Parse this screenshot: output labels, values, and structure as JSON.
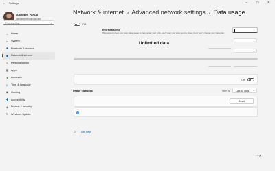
{
  "window": {
    "title": "Settings",
    "back_glyph": "←",
    "minimize_glyph": "–",
    "maximize_glyph": "□",
    "close_glyph": "✕"
  },
  "profile": {
    "name": "ABHIJEET PANDA",
    "email": "abhijeet89@outlook.com"
  },
  "search": {
    "placeholder": "Find a setting",
    "icon": "search-icon",
    "icon_glyph": "⌕"
  },
  "sidebar": {
    "items": [
      {
        "label": "Home",
        "icon": "home-icon",
        "glyph": "⌂",
        "color": "#4a4a4a"
      },
      {
        "label": "System",
        "icon": "monitor-icon",
        "glyph": "▭",
        "color": "#0067c0"
      },
      {
        "label": "Bluetooth & devices",
        "icon": "bluetooth-icon",
        "glyph": "✱",
        "color": "#0067c0"
      },
      {
        "label": "Network & internet",
        "icon": "wifi-icon",
        "glyph": "◆",
        "color": "#0067c0",
        "active": true
      },
      {
        "label": "Personalization",
        "icon": "brush-icon",
        "glyph": "✎",
        "color": "#c2593b"
      },
      {
        "label": "Apps",
        "icon": "apps-icon",
        "glyph": "▦",
        "color": "#555555"
      },
      {
        "label": "Accounts",
        "icon": "person-icon",
        "glyph": "●",
        "color": "#2a9a52"
      },
      {
        "label": "Time & language",
        "icon": "clock-icon",
        "glyph": "◷",
        "color": "#0067c0"
      },
      {
        "label": "Gaming",
        "icon": "gamepad-icon",
        "glyph": "◉",
        "color": "#555555"
      },
      {
        "label": "Accessibility",
        "icon": "accessibility-icon",
        "glyph": "✚",
        "color": "#0067c0"
      },
      {
        "label": "Privacy & security",
        "icon": "shield-icon",
        "glyph": "◈",
        "color": "#555555"
      },
      {
        "label": "Windows Update",
        "icon": "update-icon",
        "glyph": "↻",
        "color": "#0067c0"
      }
    ]
  },
  "breadcrumb": {
    "items": [
      "Network & internet",
      "Advanced network settings"
    ],
    "current": "Data usage",
    "separator": "›"
  },
  "main": {
    "top_toggle_label": "Off",
    "data_limit_title": "Enter data limit",
    "data_limit_description": "Windows can help you keep data usage to help under your limit—we'll warn you when you're close, but it won't change your data plan.",
    "unlimited_label": "Unlimited data",
    "second_toggle_label": "Off",
    "usage_statistics_title": "Usage statistics",
    "filter_label": "Filter by",
    "filter_value": "Last 30 days",
    "reset_label": "Reset",
    "info_glyph": "i",
    "get_help_label": "Get help",
    "get_help_icon_glyph": "☺"
  },
  "taskbar": {
    "tray_text": "⌃ ◔ ▭ 🔊 ⌁"
  },
  "colors": {
    "accent": "#005fb8",
    "background": "#f3f3f3"
  }
}
